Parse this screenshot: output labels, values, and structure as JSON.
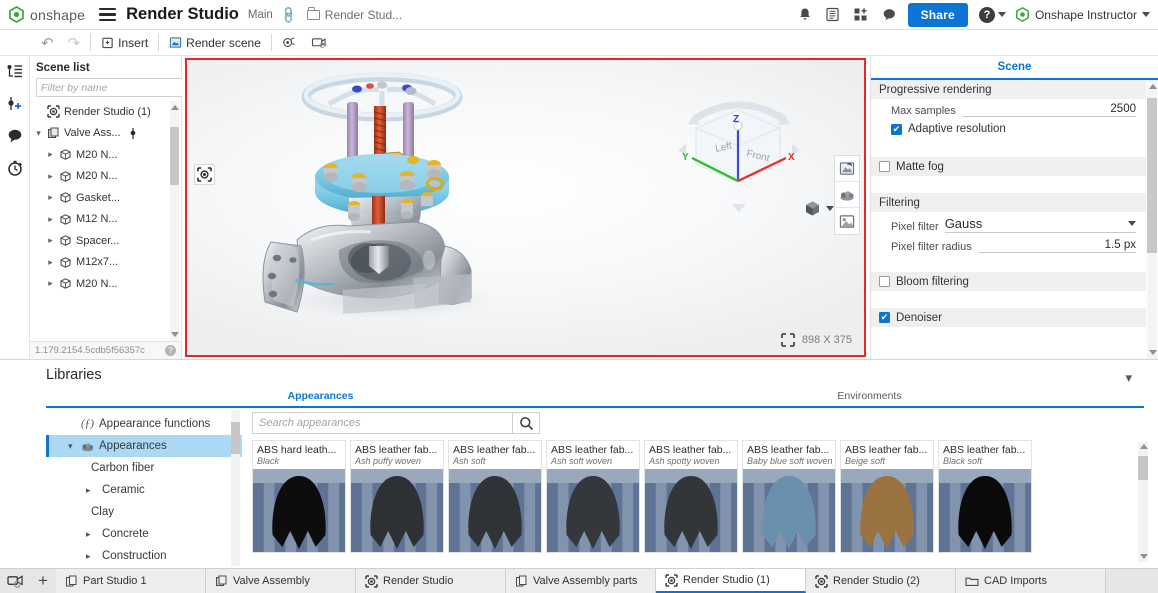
{
  "topbar": {
    "brand": "onshape",
    "doc_title": "Render Studio",
    "branch": "Main",
    "workspace": "Render Stud...",
    "share_label": "Share",
    "user_name": "Onshape Instructor",
    "icons": [
      "notification-bell-icon",
      "release-candidate-icon",
      "app-store-icon",
      "comments-icon"
    ]
  },
  "toolbar": {
    "undo_label": "↶",
    "redo_label": "↷",
    "insert_label": "Insert",
    "render_scene_label": "Render scene",
    "camera_label": "",
    "environment_label": ""
  },
  "left_rail": {
    "items": [
      {
        "name": "scene-list-icon"
      },
      {
        "name": "add-light-icon"
      },
      {
        "name": "comments-icon"
      },
      {
        "name": "history-icon"
      }
    ],
    "bottom_icon": "search-render-icon"
  },
  "scene_list": {
    "title": "Scene list",
    "filter_placeholder": "Filter by name",
    "filter_value": "",
    "menu_icon": "list-options-icon",
    "items": [
      {
        "label": "Render Studio (1)",
        "level": 0,
        "chevron": "",
        "icon": "render-studio-icon"
      },
      {
        "label": "Valve Ass...",
        "level": 0,
        "chevron": "open",
        "icon": "assembly-icon",
        "has_light": true
      },
      {
        "label": "M20 N...",
        "level": 1,
        "chevron": "closed",
        "icon": "part-icon"
      },
      {
        "label": "M20 N...",
        "level": 1,
        "chevron": "closed",
        "icon": "part-icon"
      },
      {
        "label": "Gasket...",
        "level": 1,
        "chevron": "closed",
        "icon": "part-icon"
      },
      {
        "label": "M12 N...",
        "level": 1,
        "chevron": "closed",
        "icon": "part-icon"
      },
      {
        "label": "Spacer...",
        "level": 1,
        "chevron": "closed",
        "icon": "part-icon"
      },
      {
        "label": "M12x7...",
        "level": 1,
        "chevron": "closed",
        "icon": "part-icon"
      },
      {
        "label": "M20 N...",
        "level": 1,
        "chevron": "closed",
        "icon": "part-icon"
      }
    ],
    "footer_version": "1.179.2154.5cdb5f56357c",
    "footer_help_icon": "help-icon"
  },
  "viewport": {
    "resolution": "898 X 375",
    "resolution_icon": "resize-frame-icon",
    "selection_icon": "render-region-icon",
    "side_buttons": [
      "render-preview-icon",
      "appearance-icon",
      "environment-image-icon"
    ],
    "view_cube": {
      "faces": [
        "Left",
        "Front"
      ],
      "axes": [
        {
          "label": "Z",
          "color": "#2b3fd8"
        },
        {
          "label": "X",
          "color": "#ea2c2c"
        },
        {
          "label": "Y",
          "color": "#1fc21f"
        }
      ],
      "display_mode_icon": "shaded-cube-icon"
    },
    "border_color": "#e8262a"
  },
  "scene_settings": {
    "tab": "Scene",
    "groups": [
      {
        "type": "header",
        "label": "Progressive rendering"
      },
      {
        "type": "field",
        "label": "Max samples",
        "value": "2500"
      },
      {
        "type": "checkbox",
        "label": "Adaptive resolution",
        "checked": true
      },
      {
        "type": "group-check",
        "label": "Matte fog",
        "checked": false
      },
      {
        "type": "header",
        "label": "Filtering"
      },
      {
        "type": "select",
        "label": "Pixel filter",
        "value": "Gauss"
      },
      {
        "type": "field",
        "label": "Pixel filter radius",
        "value": "1.5 px"
      },
      {
        "type": "group-check",
        "label": "Bloom filtering",
        "checked": false
      },
      {
        "type": "group-check",
        "label": "Denoiser",
        "checked": true
      }
    ]
  },
  "libraries": {
    "title": "Libraries",
    "collapse_icon": "chevron-down-icon",
    "tabs": [
      {
        "label": "Appearances",
        "active": true
      },
      {
        "label": "Environments",
        "active": false
      }
    ],
    "tree": [
      {
        "label": "Appearance functions",
        "icon": "function-icon",
        "chevron": "",
        "selected": false,
        "sub": false
      },
      {
        "label": "Appearances",
        "icon": "appearances-icon",
        "chevron": "open",
        "selected": true,
        "sub": false
      },
      {
        "label": "Carbon fiber",
        "icon": "",
        "chevron": "",
        "selected": false,
        "sub": true
      },
      {
        "label": "Ceramic",
        "icon": "",
        "chevron": "closed",
        "selected": false,
        "sub": false
      },
      {
        "label": "Clay",
        "icon": "",
        "chevron": "",
        "selected": false,
        "sub": true
      },
      {
        "label": "Concrete",
        "icon": "",
        "chevron": "closed",
        "selected": false,
        "sub": false
      },
      {
        "label": "Construction",
        "icon": "",
        "chevron": "closed",
        "selected": false,
        "sub": false
      }
    ],
    "search_placeholder": "Search appearances",
    "search_value": "",
    "search_icon": "search-icon",
    "cards": [
      {
        "name": "ABS hard leath...",
        "variant": "Black",
        "color": "#0d0d0d"
      },
      {
        "name": "ABS leather fab...",
        "variant": "Ash puffy woven",
        "color": "#2e3134"
      },
      {
        "name": "ABS leather fab...",
        "variant": "Ash soft",
        "color": "#303337"
      },
      {
        "name": "ABS leather fab...",
        "variant": "Ash soft woven",
        "color": "#34373b"
      },
      {
        "name": "ABS leather fab...",
        "variant": "Ash spotty woven",
        "color": "#333639"
      },
      {
        "name": "ABS leather fab...",
        "variant": "Baby blue soft woven",
        "color": "#6b90ae"
      },
      {
        "name": "ABS leather fab...",
        "variant": "Beige soft",
        "color": "#9a7340"
      },
      {
        "name": "ABS leather fab...",
        "variant": "Black soft",
        "color": "#0a0a0a"
      }
    ]
  },
  "bottom_tabs": {
    "add_icon": "add-tab-icon",
    "search_icon": "search-tab-icon",
    "tabs": [
      {
        "label": "Part Studio 1",
        "icon": "part-studio-icon",
        "active": false
      },
      {
        "label": "Valve Assembly",
        "icon": "assembly-icon",
        "active": false
      },
      {
        "label": "Render Studio",
        "icon": "render-studio-icon",
        "active": false
      },
      {
        "label": "Valve Assembly parts",
        "icon": "part-studio-icon",
        "active": false
      },
      {
        "label": "Render Studio (1)",
        "icon": "render-studio-icon",
        "active": true
      },
      {
        "label": "Render Studio (2)",
        "icon": "render-studio-icon",
        "active": false
      },
      {
        "label": "CAD Imports",
        "icon": "folder-icon",
        "active": false
      }
    ]
  },
  "colors": {
    "accent": "#0c74d4",
    "selection": "#aad8f5",
    "border_highlight": "#e8262a",
    "onshape_green": "#3aa93a"
  }
}
